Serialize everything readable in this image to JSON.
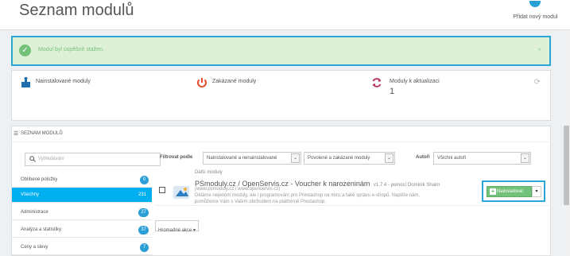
{
  "header": {
    "title": "Seznam modulů",
    "add_module_label": "Přidat nový modul"
  },
  "alert": {
    "message": "Modul byl úspěšně stažen.",
    "close": "×"
  },
  "stats": {
    "installed_label": "Nainstalované moduly",
    "disabled_label": "Zakázané moduly",
    "updates_label": "Moduly k aktualizaci",
    "updates_count": "1"
  },
  "panel": {
    "heading": "SEZNAM MODULŮ"
  },
  "search": {
    "placeholder": "Vyhledávání"
  },
  "categories": [
    {
      "label": "Oblíbené položky",
      "count": "0"
    },
    {
      "label": "Všechny",
      "count": "231"
    },
    {
      "label": "Administrace",
      "count": "27"
    },
    {
      "label": "Analýza a statistiky",
      "count": "37"
    },
    {
      "label": "Ceny a slevy",
      "count": "7"
    }
  ],
  "filters": {
    "filter_label": "Filtrovat podle",
    "status_value": "Nainstalované a nenainstalované",
    "enabled_value": "Povolené a zakázané moduly",
    "authors_label": "Autoři",
    "authors_value": "Všichni autoři"
  },
  "module": {
    "category": "Další moduly",
    "title": "PSmoduly.cz / OpenServis.cz - Voucher k narozeninám",
    "version": "v1.7.4 - pomocí Dominik Shaim",
    "desc_line1": "(www.psmoduly.cz / www.openservis.cz)",
    "desc_line2": "Děláme nejenom moduly, ale i programování pro Prestashop na míru a také správu e-shopů. Napište nám,",
    "desc_line3": "pomůžeme Vám s Vaším obchodem na platformě Prestashop.",
    "install_label": "Nainstalovat"
  },
  "bulk": {
    "label": "Hromadné akce ▾"
  },
  "colors": {
    "accent": "#00aff0",
    "badge": "#2a9fd6",
    "success": "#72c279",
    "alert_bg": "#dff0d8",
    "highlight_border": "#29a6d6"
  },
  "icons": [
    "puzzle-icon",
    "power-icon",
    "refresh-icon",
    "search-icon",
    "check-icon",
    "list-icon",
    "caret-down-icon"
  ]
}
